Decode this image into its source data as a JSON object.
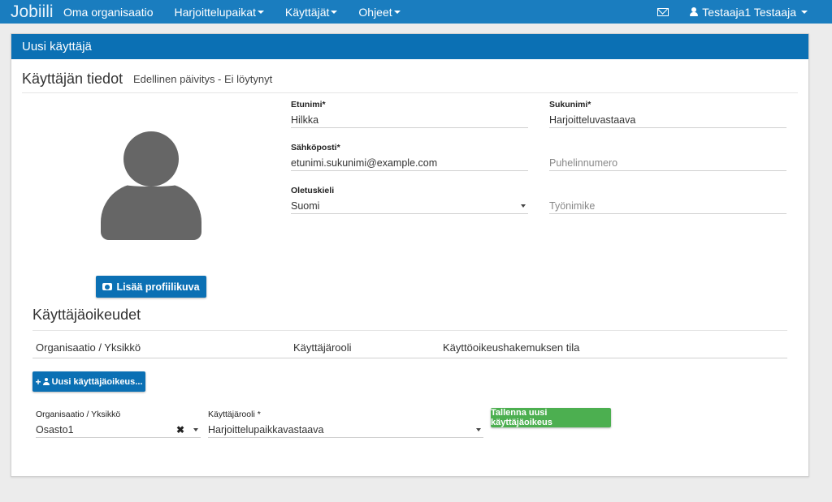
{
  "navbar": {
    "brand": "Jobiili",
    "items": [
      {
        "label": "Oma organisaatio",
        "dropdown": false
      },
      {
        "label": "Harjoittelupaikat",
        "dropdown": true
      },
      {
        "label": "Käyttäjät",
        "dropdown": true
      },
      {
        "label": "Ohjeet",
        "dropdown": true
      }
    ],
    "mail_icon": "envelope-icon",
    "user": "Testaaja1 Testaaja"
  },
  "panel": {
    "heading": "Uusi käyttäjä",
    "section_title": "Käyttäjän tiedot",
    "last_update": "Edellinen päivitys - Ei löytynyt",
    "photo_button": "Lisää profiilikuva",
    "fields": {
      "first_name": {
        "label": "Etunimi*",
        "value": "Hilkka"
      },
      "last_name": {
        "label": "Sukunimi*",
        "value": "Harjoitteluvastaava"
      },
      "email": {
        "label": "Sähköposti*",
        "value": "etunimi.sukunimi@example.com"
      },
      "phone": {
        "placeholder": "Puhelinnumero"
      },
      "language": {
        "label": "Oletuskieli",
        "value": "Suomi"
      },
      "job_title": {
        "placeholder": "Työnimike"
      }
    }
  },
  "permissions": {
    "title": "Käyttäjäoikeudet",
    "columns": [
      "Organisaatio / Yksikkö",
      "Käyttäjärooli",
      "Käyttöoikeushakemuksen tila"
    ],
    "new_button": "Uusi käyttäjäoikeus...",
    "new_row": {
      "org_label": "Organisaatio / Yksikkö",
      "org_value": "Osasto1",
      "role_label": "Käyttäjärooli *",
      "role_value": "Harjoittelupaikkavastaava",
      "save_button": "Tallenna uusi käyttäjäoikeus"
    }
  },
  "colors": {
    "navbar": "#1a7dbf",
    "panel_heading": "#0b70b4",
    "save": "#4caf50"
  }
}
